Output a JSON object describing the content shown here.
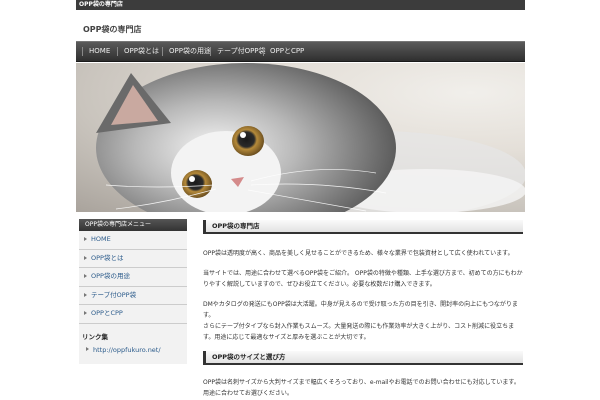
{
  "topbar": {
    "text": "OPP袋の専門店"
  },
  "header": {
    "title": "OPP袋の専門店"
  },
  "nav": {
    "items": [
      "HOME",
      "OPP袋とは",
      "OPP袋の用途",
      "テープ付OPP袋",
      "OPPとCPP"
    ]
  },
  "hero": {
    "alt": "kitten photo"
  },
  "sidebar": {
    "heading": "OPP袋の専門店メニュー",
    "items": [
      "HOME",
      "OPP袋とは",
      "OPP袋の用途",
      "テープ付OPP袋",
      "OPPとCPP"
    ],
    "sub_heading": "リンク集",
    "link": "http://oppfukuro.net/"
  },
  "content": {
    "section1_title": "OPP袋の専門店",
    "p1": "OPP袋は透明度が高く、商品を美しく見せることができるため、様々な業界で包装資材として広く使われています。",
    "p2": "当サイトでは、用途に合わせて選べるOPP袋をご紹介。 OPP袋の特徴や種類、上手な選び方まで、初めての方にもわかりやすく解説していますので、ぜひお役立てください。必要な枚数だけ購入できます。",
    "p3": "DMやカタログの発送にもOPP袋は大活躍。中身が見えるので受け取った方の目を引き、開封率の向上にもつながります。",
    "p4": "さらにテープ付タイプなら封入作業もスムーズ。大量発送の際にも作業効率が大きく上がり、コスト削減に役立ちます。用途に応じて最適なサイズと厚みを選ぶことが大切です。",
    "section2_title": "OPP袋のサイズと選び方",
    "p5": "OPP袋は名刺サイズから大判サイズまで幅広くそろっており、e-mailやお電話でのお問い合わせにも対応しています。用途に合わせてお選びください。"
  }
}
